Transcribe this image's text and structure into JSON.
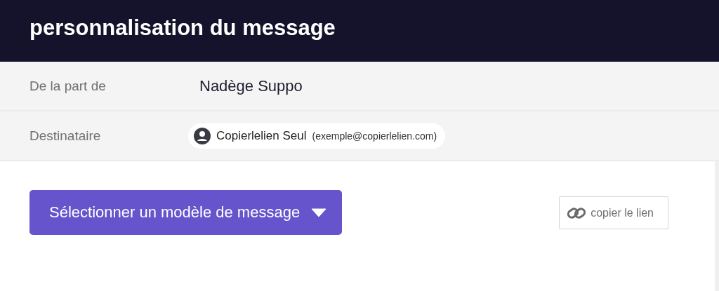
{
  "header": {
    "title": "personnalisation du message"
  },
  "fields": [
    {
      "label": "De la part de",
      "kind": "text",
      "value": "Nadège Suppo"
    },
    {
      "label": "Destinataire",
      "kind": "chip",
      "name": "Copierlelien Seul",
      "email": "(exemple@copierlelien.com)"
    }
  ],
  "template_button": {
    "label": "Sélectionner un modèle de message"
  },
  "copy_link": {
    "label": "copier le lien"
  }
}
